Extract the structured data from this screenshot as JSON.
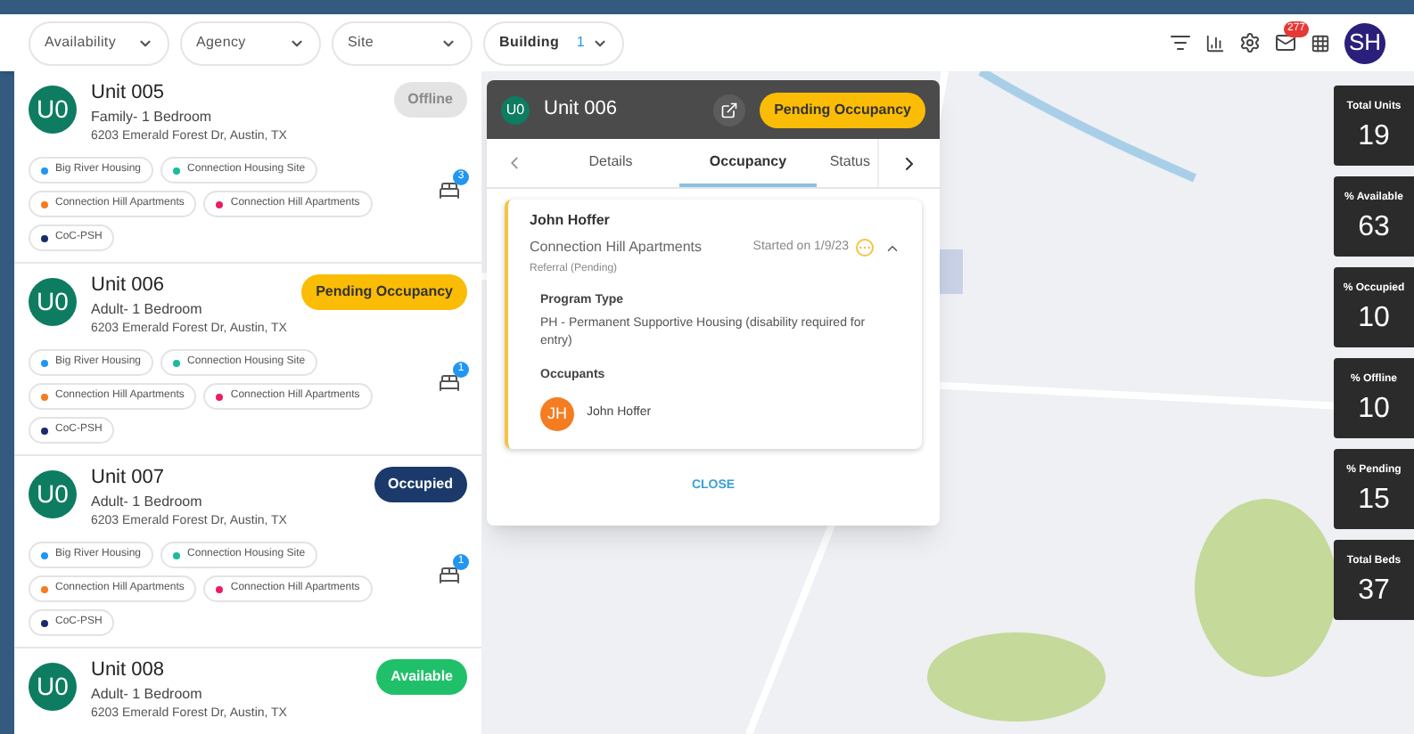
{
  "filters": [
    {
      "label": "Availability",
      "bold": false
    },
    {
      "label": "Agency",
      "bold": false
    },
    {
      "label": "Site",
      "bold": false
    },
    {
      "label": "Building",
      "bold": true,
      "count": "1"
    }
  ],
  "header": {
    "mail_badge": "277",
    "avatar": "SH"
  },
  "units": [
    {
      "avatar": "U0",
      "name": "Unit 005",
      "type": "Family- 1 Bedroom",
      "address": "6203 Emerald Forest Dr, Austin, TX",
      "status": {
        "label": "Offline",
        "kind": "offline"
      },
      "bed_badge": "3",
      "tags": [
        {
          "label": "Big River Housing",
          "color": "#2196f3"
        },
        {
          "label": "Connection Housing Site",
          "color": "#1abc9c"
        },
        {
          "label": "Connection Hill Apartments",
          "color": "#f57c20"
        },
        {
          "label": "Connection Hill Apartments",
          "color": "#e91e63"
        },
        {
          "label": "CoC-PSH",
          "color": "#1a2a6c"
        }
      ]
    },
    {
      "avatar": "U0",
      "name": "Unit 006",
      "type": "Adult- 1 Bedroom",
      "address": "6203 Emerald Forest Dr, Austin, TX",
      "status": {
        "label": "Pending Occupancy",
        "kind": "pending"
      },
      "bed_badge": "1",
      "tags": [
        {
          "label": "Big River Housing",
          "color": "#2196f3"
        },
        {
          "label": "Connection Housing Site",
          "color": "#1abc9c"
        },
        {
          "label": "Connection Hill Apartments",
          "color": "#f57c20"
        },
        {
          "label": "Connection Hill Apartments",
          "color": "#e91e63"
        },
        {
          "label": "CoC-PSH",
          "color": "#1a2a6c"
        }
      ]
    },
    {
      "avatar": "U0",
      "name": "Unit 007",
      "type": "Adult- 1 Bedroom",
      "address": "6203 Emerald Forest Dr, Austin, TX",
      "status": {
        "label": "Occupied",
        "kind": "occupied"
      },
      "bed_badge": "1",
      "tags": [
        {
          "label": "Big River Housing",
          "color": "#2196f3"
        },
        {
          "label": "Connection Housing Site",
          "color": "#1abc9c"
        },
        {
          "label": "Connection Hill Apartments",
          "color": "#f57c20"
        },
        {
          "label": "Connection Hill Apartments",
          "color": "#e91e63"
        },
        {
          "label": "CoC-PSH",
          "color": "#1a2a6c"
        }
      ]
    },
    {
      "avatar": "U0",
      "name": "Unit 008",
      "type": "Adult- 1 Bedroom",
      "address": "6203 Emerald Forest Dr, Austin, TX",
      "status": {
        "label": "Available",
        "kind": "available"
      }
    }
  ],
  "popup": {
    "avatar": "U0",
    "title": "Unit 006",
    "status": {
      "label": "Pending Occupancy",
      "kind": "pending"
    },
    "tabs": [
      {
        "label": "Details",
        "selected": false
      },
      {
        "label": "Occupancy",
        "selected": true
      },
      {
        "label": "Status",
        "selected": false
      }
    ],
    "referral": {
      "name": "John Hoffer",
      "site": "Connection Hill Apartments",
      "state": "Referral (Pending)",
      "started": "Started on 1/9/23",
      "expanded": true,
      "program_type_label": "Program Type",
      "program_type": "PH - Permanent Supportive Housing (disability required for entry)",
      "occupants_label": "Occupants",
      "occupants": [
        {
          "initials": "JH",
          "name": "John Hoffer"
        }
      ]
    },
    "close": "CLOSE"
  },
  "stats": [
    {
      "label": "Total Units",
      "value": "19"
    },
    {
      "label": "% Available",
      "value": "63"
    },
    {
      "label": "% Occupied",
      "value": "10"
    },
    {
      "label": "% Offline",
      "value": "10"
    },
    {
      "label": "% Pending",
      "value": "15"
    },
    {
      "label": "Total Beds",
      "value": "37"
    }
  ]
}
